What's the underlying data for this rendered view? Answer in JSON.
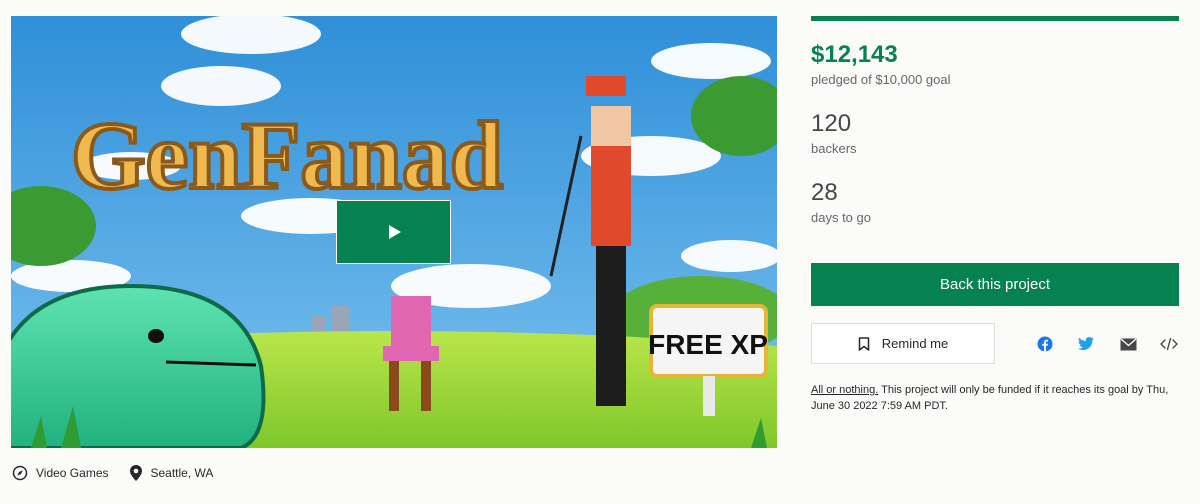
{
  "hero": {
    "play_icon": "play-icon",
    "banner_title": "GenFanad",
    "sign_text": "FREE XP"
  },
  "meta": {
    "category": {
      "icon": "compass-icon",
      "label": "Video Games"
    },
    "location": {
      "icon": "map-pin-icon",
      "label": "Seattle, WA"
    }
  },
  "stats": {
    "progress_percent": 100,
    "pledged_amount": "$12,143",
    "pledged_label": "pledged of $10,000 goal",
    "backers_count": "120",
    "backers_label": "backers",
    "days_count": "28",
    "days_label": "days to go"
  },
  "actions": {
    "back_label": "Back this project",
    "remind_label": "Remind me",
    "remind_icon": "bookmark-icon",
    "share_icons": [
      "facebook-icon",
      "twitter-icon",
      "email-icon",
      "embed-icon"
    ]
  },
  "funding_note": {
    "link_text": "All or nothing.",
    "text": " This project will only be funded if it reaches its goal by Thu, June 30 2022 7:59 AM PDT."
  },
  "colors": {
    "accent": "#05824f",
    "track": "#e6e6e6",
    "facebook": "#1877f2",
    "twitter": "#1da1f2",
    "icon_gray": "#474747"
  }
}
